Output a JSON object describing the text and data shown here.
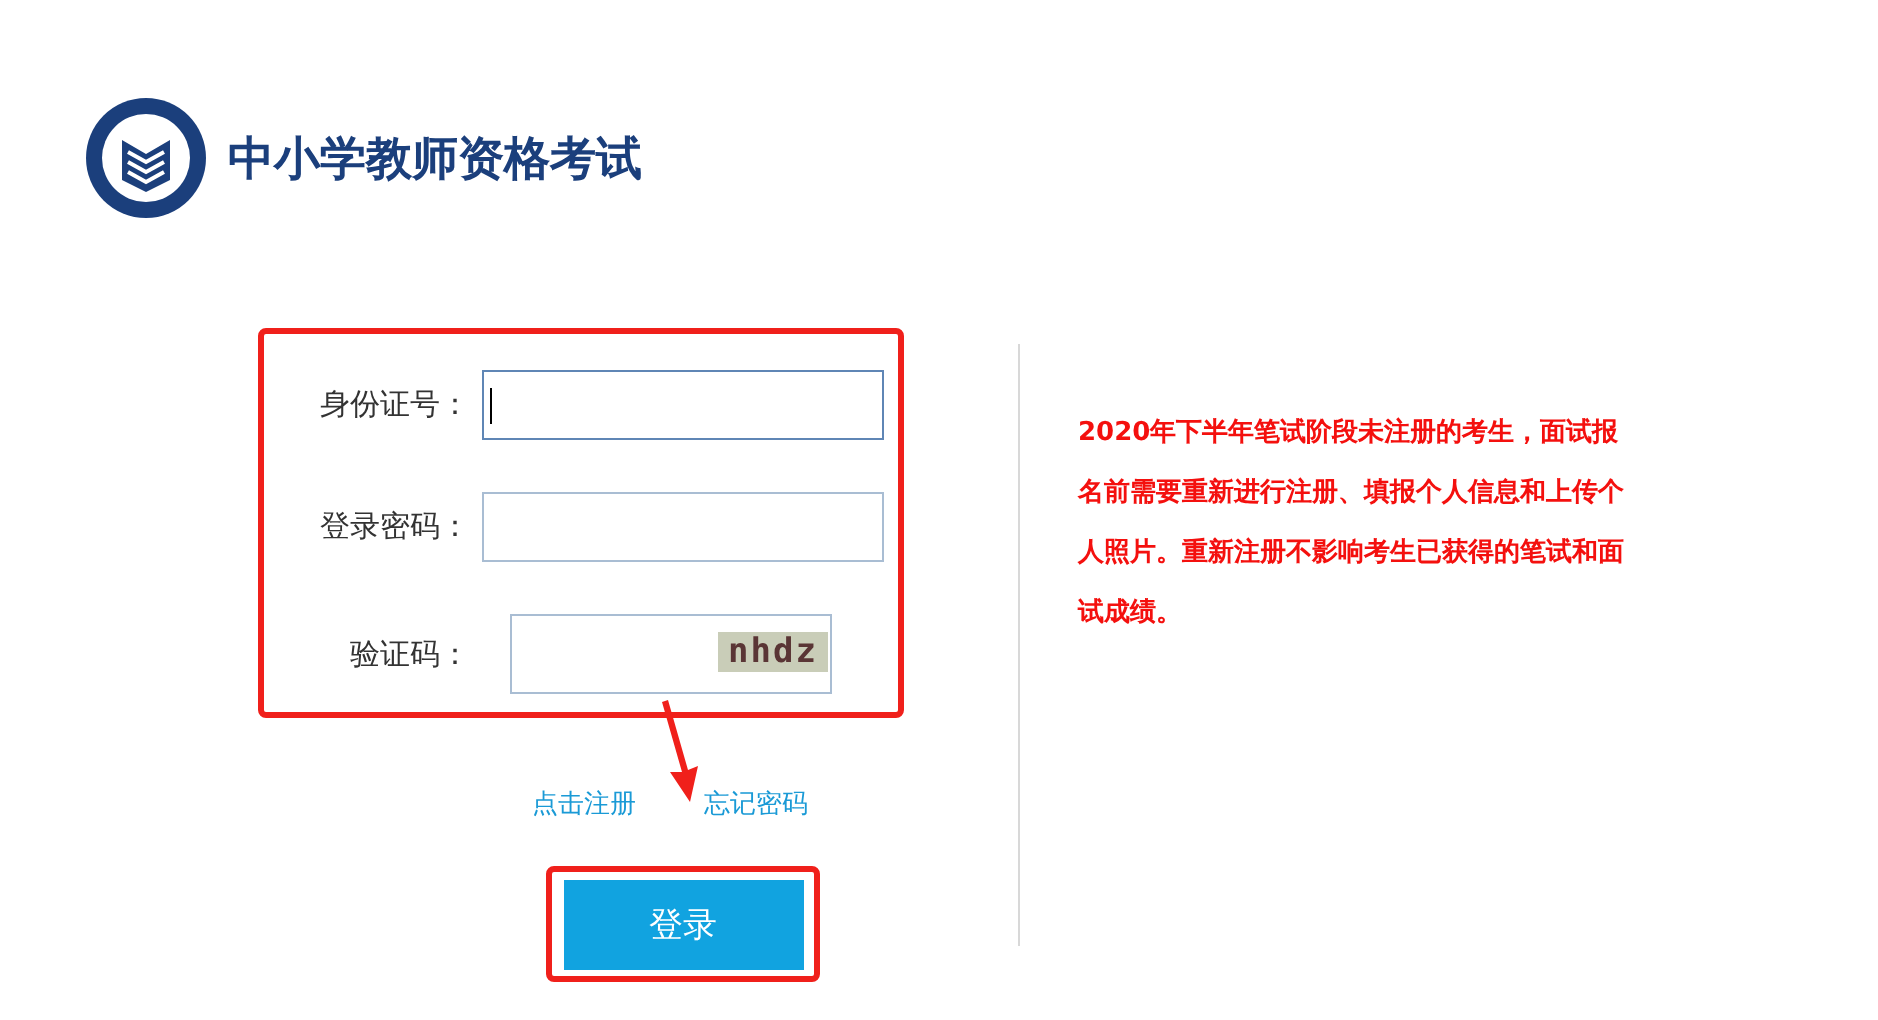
{
  "header": {
    "title": "中小学教师资格考试"
  },
  "form": {
    "fields": [
      {
        "kind": "text",
        "label": "身份证号：",
        "focused": true
      },
      {
        "kind": "password",
        "label": "登录密码：",
        "focused": false
      },
      {
        "kind": "captcha",
        "label": "验证码：",
        "focused": false,
        "captcha": "nhdz"
      }
    ],
    "links": [
      "点击注册",
      "忘记密码"
    ],
    "submit": "登录"
  },
  "notice": "2020年下半年笔试阶段未注册的考生，面试报名前需要重新进行注册、填报个人信息和上传个人照片。重新注册不影响考生已获得的笔试和面试成绩。"
}
